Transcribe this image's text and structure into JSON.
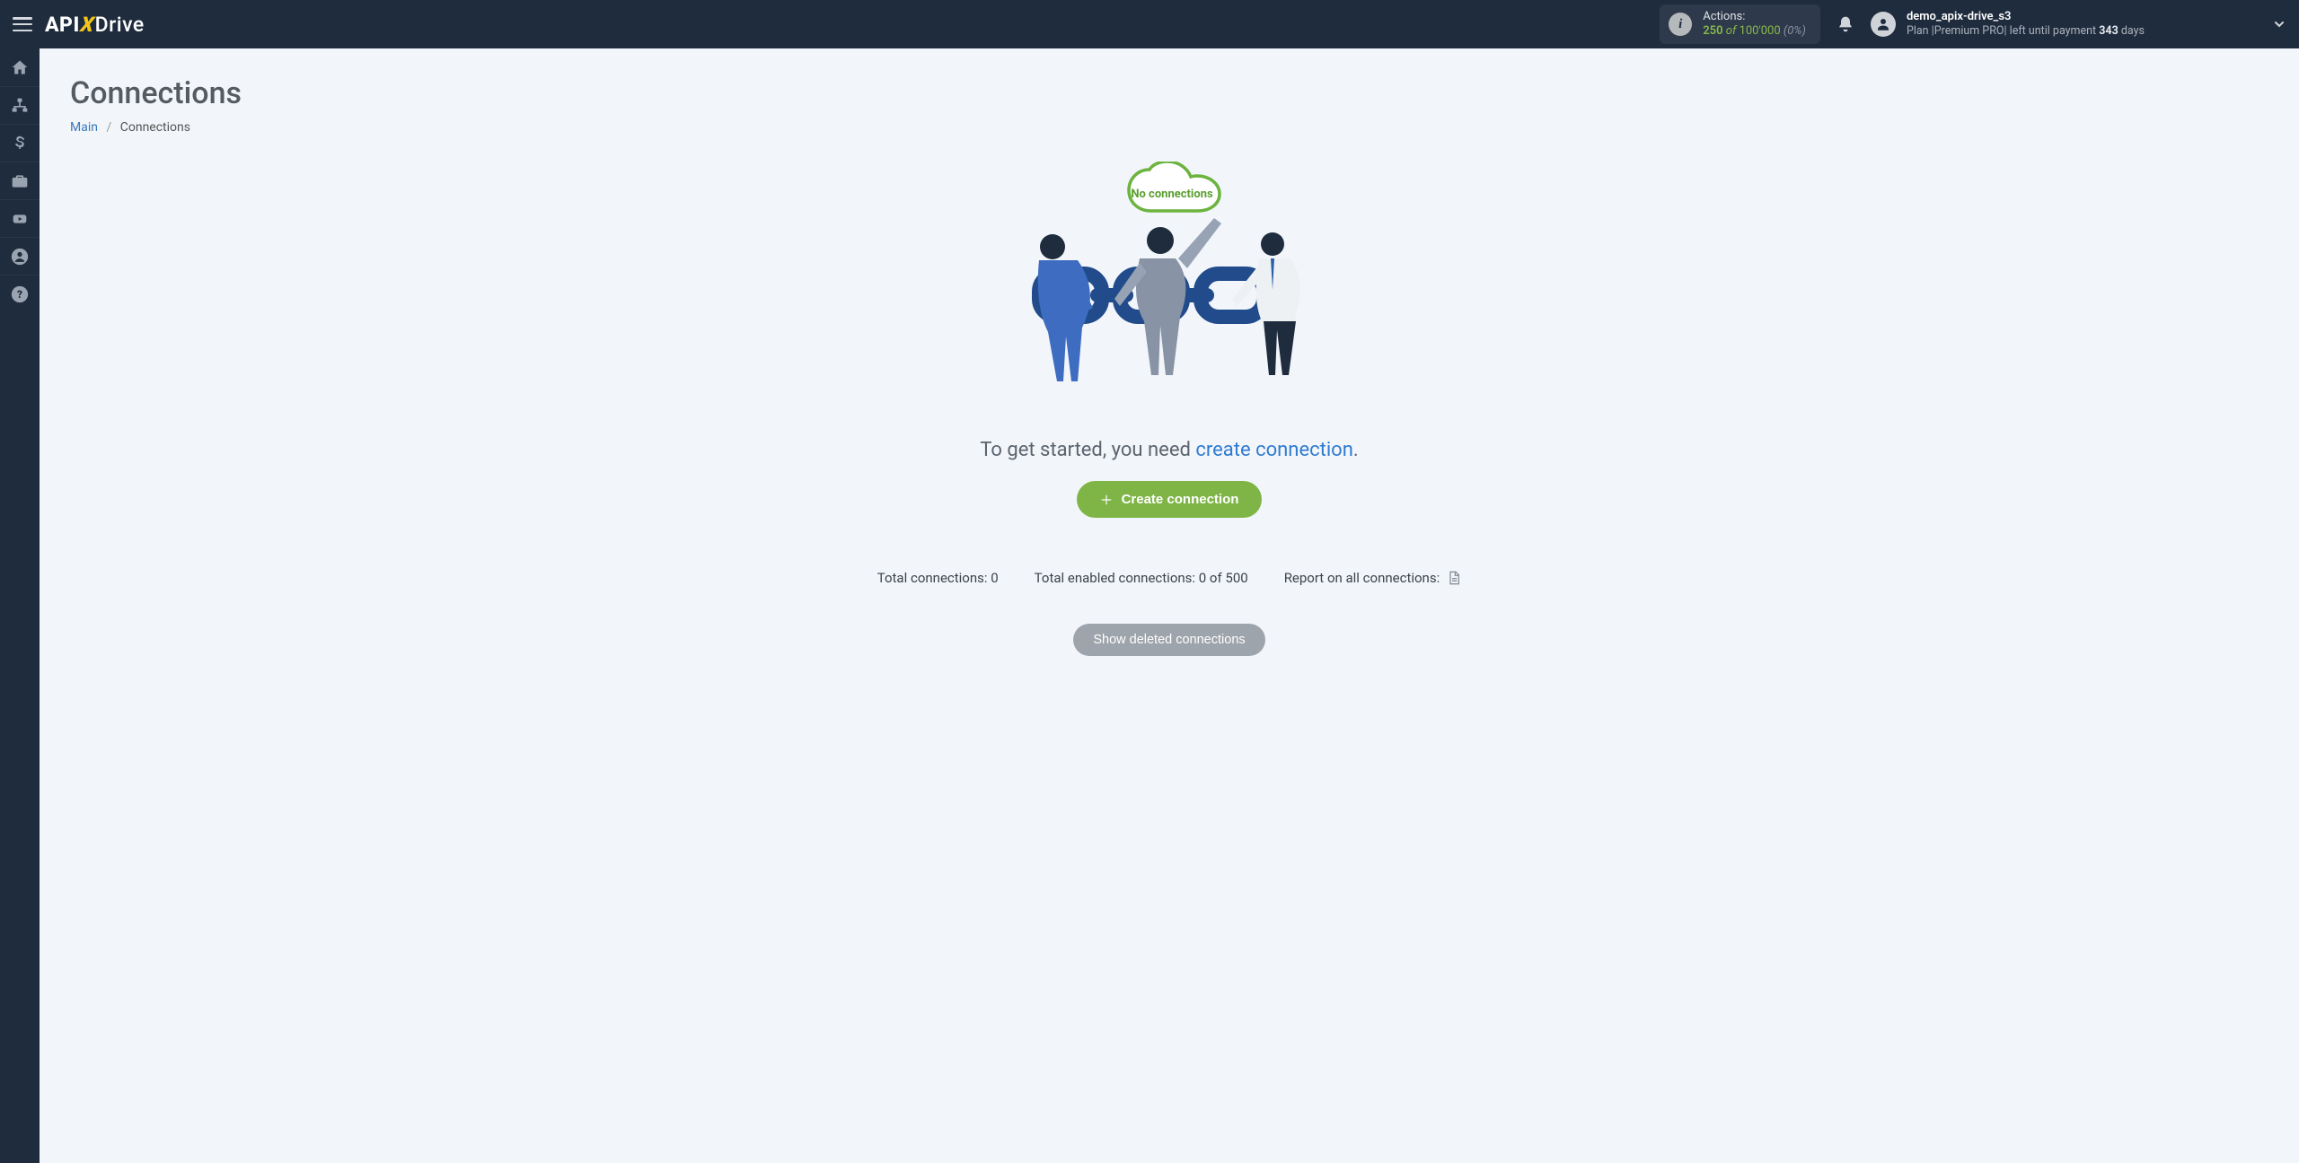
{
  "header": {
    "logo_text_1": "API",
    "logo_text_2": "X",
    "logo_text_3": "Drive",
    "actions": {
      "label": "Actions:",
      "used": "250",
      "of": "of",
      "total": "100'000",
      "pct": "(0%)"
    },
    "user": {
      "name": "demo_apix-drive_s3",
      "plan_prefix": "Plan |",
      "plan_name": "Premium PRO",
      "plan_sep": "| left until payment ",
      "days_num": "343",
      "days_suffix": " days"
    }
  },
  "sidebar": {
    "items": [
      "home",
      "sitemap",
      "billing",
      "briefcase",
      "video",
      "account",
      "help"
    ]
  },
  "page": {
    "title": "Connections",
    "breadcrumb_main": "Main",
    "breadcrumb_current": "Connections",
    "cloud_label": "No connections",
    "get_started_prefix": "To get started, you need ",
    "get_started_link": "create connection",
    "get_started_suffix": ".",
    "create_btn": "Create connection",
    "stats": {
      "total": "Total connections: 0",
      "enabled": "Total enabled connections: 0 of 500",
      "report": "Report on all connections:"
    },
    "show_deleted": "Show deleted connections"
  }
}
